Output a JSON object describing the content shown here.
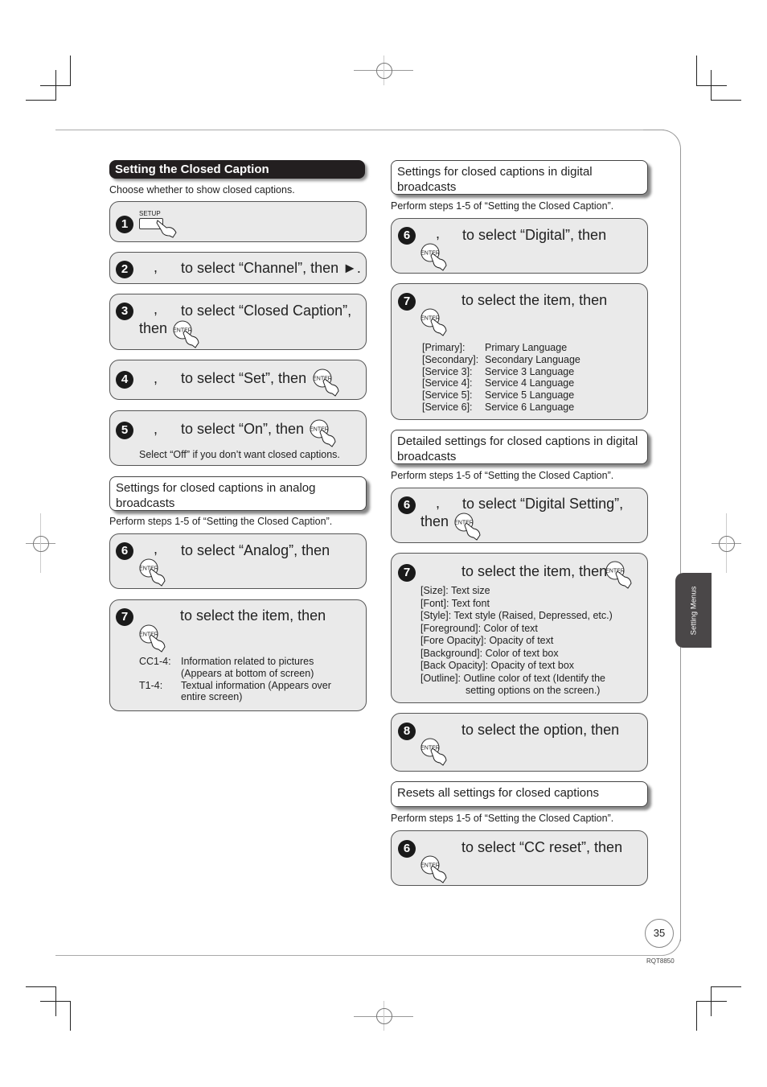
{
  "section_title": "Setting the Closed Caption",
  "section_subtitle": "Choose whether to show closed captions.",
  "perform_note": "Perform steps 1-5 of “Setting the Closed Caption”.",
  "buttons": {
    "setup": "SETUP",
    "enter": "ENTER"
  },
  "left_steps": [
    {
      "num": "1",
      "text": ""
    },
    {
      "num": "2",
      "comma": ",",
      "text": "to select “Channel”, then ►."
    },
    {
      "num": "3",
      "comma": ",",
      "text": "to select “Closed Caption”,",
      "text2": "then"
    },
    {
      "num": "4",
      "comma": ",",
      "text": "to select “Set”, then"
    },
    {
      "num": "5",
      "comma": ",",
      "text": "to select “On”, then",
      "note": "Select “Off” if you don’t want closed captions."
    }
  ],
  "analog": {
    "header": "Settings for closed captions in analog broadcasts",
    "step6": {
      "num": "6",
      "comma": ",",
      "text": "to select “Analog”, then"
    },
    "step7": {
      "num": "7",
      "text": "to select the item, then",
      "items": [
        {
          "key": "CC1-4:",
          "value": "Information related to pictures",
          "value2": "(Appears at bottom of screen)"
        },
        {
          "key": "T1-4:",
          "value": "Textual information (Appears over",
          "value2": "entire screen)"
        }
      ]
    }
  },
  "digital": {
    "header": "Settings for closed captions in digital broadcasts",
    "step6": {
      "num": "6",
      "comma": ",",
      "text": "to select “Digital”, then"
    },
    "step7": {
      "num": "7",
      "text": "to select the item, then",
      "items": [
        {
          "key": "[Primary]:",
          "value": "Primary Language"
        },
        {
          "key": "[Secondary]:",
          "value": "Secondary Language"
        },
        {
          "key": "[Service 3]:",
          "value": "Service 3 Language"
        },
        {
          "key": "[Service 4]:",
          "value": "Service 4 Language"
        },
        {
          "key": "[Service 5]:",
          "value": "Service 5 Language"
        },
        {
          "key": "[Service 6]:",
          "value": "Service 6 Language"
        }
      ]
    }
  },
  "detailed": {
    "header": "Detailed settings for closed captions in digital broadcasts",
    "step6": {
      "num": "6",
      "comma": ",",
      "text": "to select “Digital Setting”,",
      "text2": "then"
    },
    "step7": {
      "num": "7",
      "text": "to select the item, then",
      "items": [
        "[Size]: Text size",
        "[Font]: Text font",
        "[Style]: Text style (Raised, Depressed, etc.)",
        "[Foreground]: Color of text",
        "[Fore Opacity]: Opacity of text",
        "[Background]: Color of text box",
        "[Back Opacity]: Opacity of text box",
        "[Outline]: Outline color of text (Identify the",
        "setting options on the screen.)"
      ]
    },
    "step8": {
      "num": "8",
      "text": "to select the option, then"
    }
  },
  "reset": {
    "header": "Resets all settings for closed captions",
    "step6": {
      "num": "6",
      "text": "to select “CC reset”, then"
    }
  },
  "side_tab": "Setting Menus",
  "page_number": "35",
  "doc_code": "RQT8850"
}
